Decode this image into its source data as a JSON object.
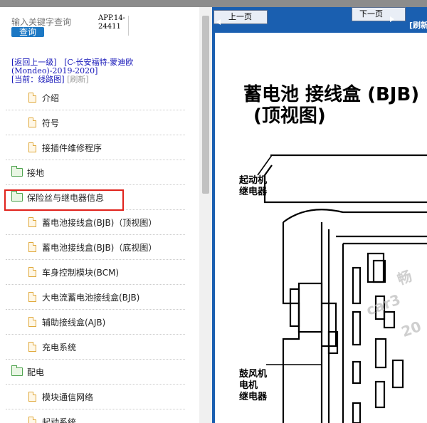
{
  "search": {
    "placeholder": "输入关键字查询",
    "button_label": "查询"
  },
  "app_version": "APP.14-24411",
  "nav": {
    "back_label": "[返回上一级]",
    "path_label": "[C-长安福特-蒙迪欧(Mondeo)-2019-2020]",
    "current_prefix": "[当前：线路图]",
    "refresh_label": "[刷新]"
  },
  "tree": [
    {
      "type": "file",
      "label": "介绍"
    },
    {
      "type": "file",
      "label": "符号"
    },
    {
      "type": "file",
      "label": "接插件维修程序"
    },
    {
      "type": "folder",
      "label": "接地"
    },
    {
      "type": "folder",
      "label": "保险丝与继电器信息",
      "highlighted": true
    },
    {
      "type": "file",
      "label": "蓄电池接线盒(BJB)（顶视图）"
    },
    {
      "type": "file",
      "label": "蓄电池接线盒(BJB)（底视图）"
    },
    {
      "type": "file",
      "label": "车身控制模块(BCM)"
    },
    {
      "type": "file",
      "label": "大电流蓄电池接线盒(BJB)"
    },
    {
      "type": "file",
      "label": "辅助接线盒(AJB)"
    },
    {
      "type": "file",
      "label": "充电系统"
    },
    {
      "type": "folder",
      "label": "配电"
    },
    {
      "type": "file",
      "label": "模块通信网络"
    },
    {
      "type": "file",
      "label": "起动系统"
    }
  ],
  "viewer": {
    "prev_label": "上一页",
    "next_label": "下一页",
    "refresh_label": "[刷新]",
    "title_line1": "蓄电池 接线盒 (BJB)",
    "title_line2": "(顶视图)",
    "label_starter": "起动机\n继电器",
    "label_blower": "鼓风机\n电机\n继电器",
    "watermark1": "畅",
    "watermark2": "car3",
    "watermark3": "20"
  },
  "colors": {
    "accent": "#1c78c4",
    "highlight": "#e0221b",
    "viewer_bg": "#1a5fb0"
  }
}
